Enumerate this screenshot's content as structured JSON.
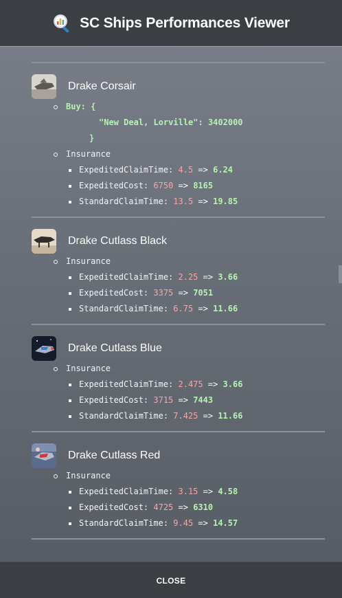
{
  "header": {
    "title": "SC Ships Performances Viewer",
    "logo_icon": "magnifier-chart-icon"
  },
  "ships": [
    {
      "name": "Drake Corsair",
      "buy": {
        "label": "Buy: {",
        "entry": "\"New Deal, Lorville\": 3402000",
        "close": "}"
      },
      "insurance_label": "Insurance",
      "insurance": [
        {
          "key": "ExpeditedClaimTime",
          "old": "4.5",
          "arrow": "=>",
          "new": "6.24"
        },
        {
          "key": "ExpeditedCost",
          "old": "6750",
          "arrow": "=>",
          "new": "8165"
        },
        {
          "key": "StandardClaimTime",
          "old": "13.5",
          "arrow": "=>",
          "new": "19.85"
        }
      ]
    },
    {
      "name": "Drake Cutlass Black",
      "insurance_label": "Insurance",
      "insurance": [
        {
          "key": "ExpeditedClaimTime",
          "old": "2.25",
          "arrow": "=>",
          "new": "3.66"
        },
        {
          "key": "ExpeditedCost",
          "old": "3375",
          "arrow": "=>",
          "new": "7051"
        },
        {
          "key": "StandardClaimTime",
          "old": "6.75",
          "arrow": "=>",
          "new": "11.66"
        }
      ]
    },
    {
      "name": "Drake Cutlass Blue",
      "insurance_label": "Insurance",
      "insurance": [
        {
          "key": "ExpeditedClaimTime",
          "old": "2.475",
          "arrow": "=>",
          "new": "3.66"
        },
        {
          "key": "ExpeditedCost",
          "old": "3715",
          "arrow": "=>",
          "new": "7443"
        },
        {
          "key": "StandardClaimTime",
          "old": "7.425",
          "arrow": "=>",
          "new": "11.66"
        }
      ]
    },
    {
      "name": "Drake Cutlass Red",
      "insurance_label": "Insurance",
      "insurance": [
        {
          "key": "ExpeditedClaimTime",
          "old": "3.15",
          "arrow": "=>",
          "new": "4.58"
        },
        {
          "key": "ExpeditedCost",
          "old": "4725",
          "arrow": "=>",
          "new": "6310"
        },
        {
          "key": "StandardClaimTime",
          "old": "9.45",
          "arrow": "=>",
          "new": "14.57"
        }
      ]
    }
  ],
  "footer": {
    "close_label": "CLOSE"
  },
  "colors": {
    "old_value": "#f3a7a7",
    "new_value": "#b5f3b0",
    "header_bg": "#3b3e43"
  }
}
